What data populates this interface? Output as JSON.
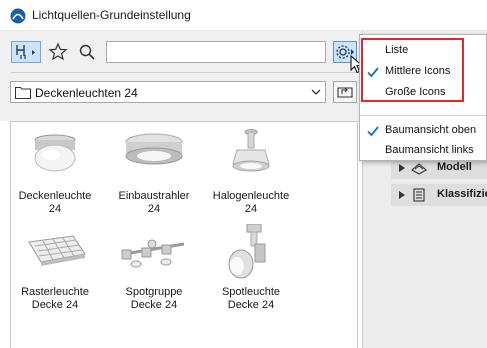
{
  "window": {
    "title": "Lichtquellen-Grundeinstellung"
  },
  "toolbar": {
    "search_value": "",
    "search_placeholder": ""
  },
  "folder": {
    "selected": "Deckenleuchten 24"
  },
  "items": [
    {
      "line1": "Deckenleuchte",
      "line2": "24"
    },
    {
      "line1": "Einbaustrahler",
      "line2": "24"
    },
    {
      "line1": "Halogenleuchte",
      "line2": "24"
    },
    {
      "line1": "Rasterleuchte",
      "line2": "Decke 24"
    },
    {
      "line1": "Spotgruppe",
      "line2": "Decke 24"
    },
    {
      "line1": "Spotleuchte",
      "line2": "Decke 24"
    }
  ],
  "menu": {
    "items": [
      {
        "label": "Liste",
        "checked": false
      },
      {
        "label": "Mittlere Icons",
        "checked": true
      },
      {
        "label": "Große Icons",
        "checked": false
      },
      {
        "label": "Baumansicht oben",
        "checked": true
      },
      {
        "label": "Baumansicht links",
        "checked": false
      }
    ]
  },
  "tree": {
    "rows": [
      {
        "label": "Modell",
        "icon": "model-icon"
      },
      {
        "label": "Klassifizie",
        "icon": "classification-icon"
      }
    ]
  },
  "colors": {
    "accent": "#1a6fc4",
    "highlight": "#e3262b",
    "selected_bg": "#cfe3f8"
  }
}
